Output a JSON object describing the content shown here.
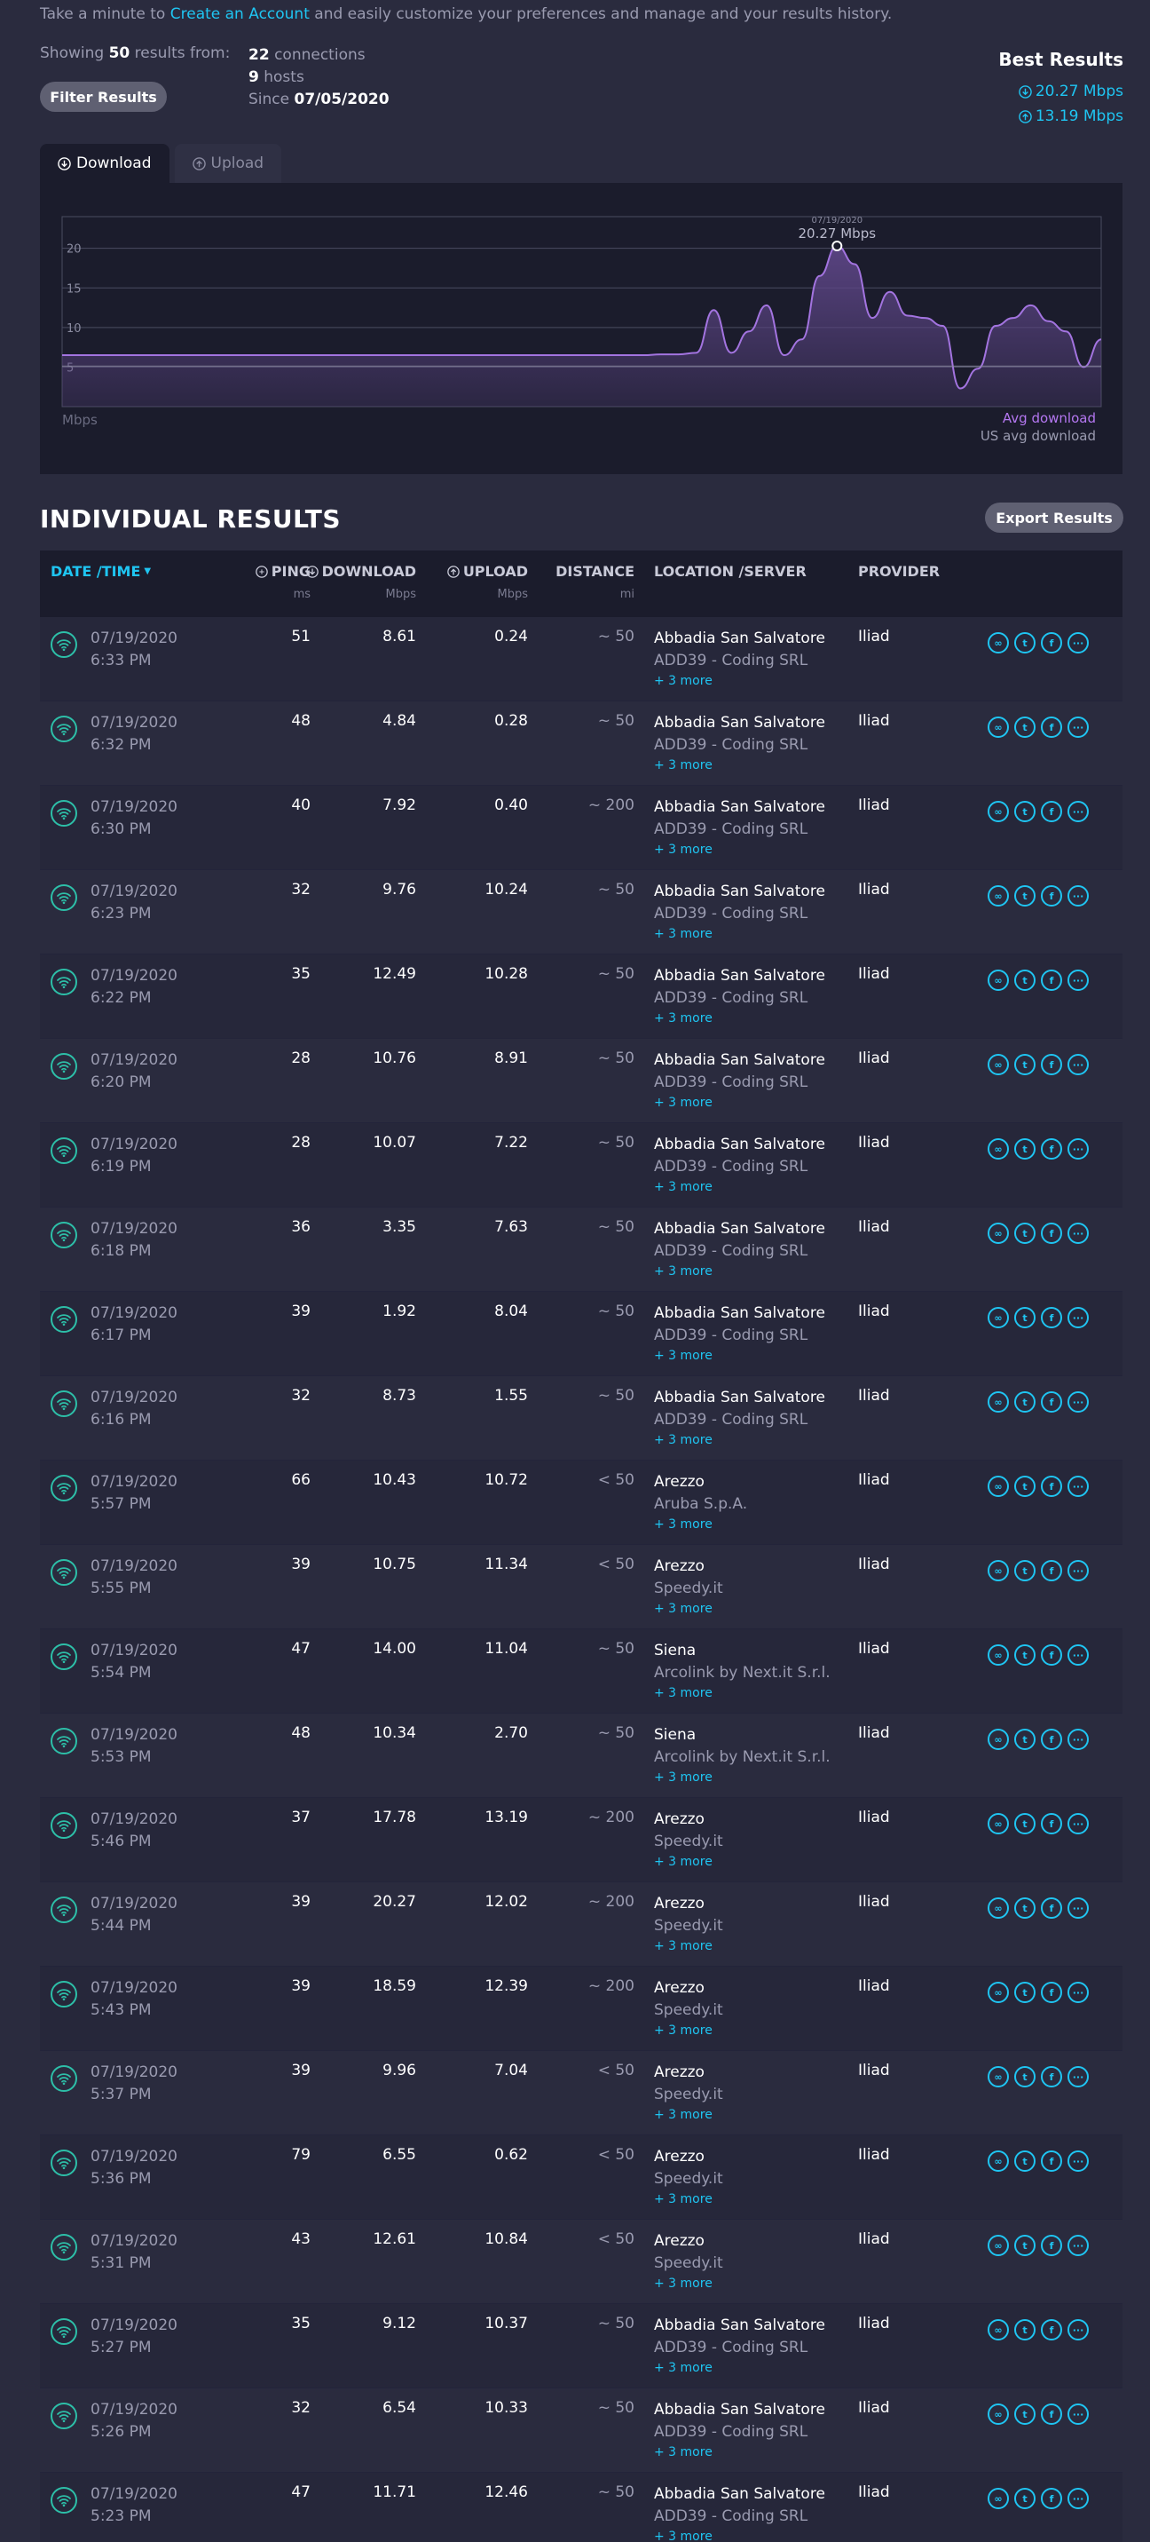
{
  "intro": {
    "before": "Take a minute to",
    "link": "Create an Account",
    "after": "and easily customize your preferences and manage and your results history."
  },
  "summary": {
    "showing_label": "Showing",
    "count": "50",
    "from_label": "results from:",
    "connections_count": "22",
    "connections_label": "connections",
    "hosts_count": "9",
    "hosts_label": "hosts",
    "since_label": "Since",
    "since_date": "07/05/2020"
  },
  "filter_button": "Filter Results",
  "best": {
    "title": "Best Results",
    "download": "20.27 Mbps",
    "upload": "13.19 Mbps"
  },
  "tabs": [
    {
      "label": "Download"
    },
    {
      "label": "Upload"
    }
  ],
  "chart": {
    "tooltip_date": "07/19/2020",
    "tooltip_value": "20.27 Mbps",
    "unit": "Mbps",
    "legend_avg": "Avg download",
    "legend_us": "US avg download",
    "colors": {
      "line": "#a374e0",
      "fill": "#5c4585",
      "us_line": "#8a8aa0"
    }
  },
  "chart_data": {
    "type": "area",
    "ylabel": "Mbps",
    "yticks": [
      "5",
      "10",
      "15",
      "20"
    ],
    "ylim": [
      0,
      24
    ],
    "series": [
      {
        "name": "Avg download",
        "values": [
          6.5,
          6.5,
          6.5,
          6.5,
          6.5,
          6.5,
          6.5,
          6.5,
          6.5,
          6.5,
          6.5,
          6.5,
          6.5,
          6.5,
          6.5,
          6.5,
          6.5,
          6.5,
          6.5,
          6.5,
          6.5,
          6.5,
          6.5,
          6.5,
          6.5,
          6.5,
          6.5,
          6.5,
          6.5,
          6.5,
          6.5,
          6.5,
          6.5,
          6.5,
          6.6,
          6.6,
          6.8,
          12.2,
          6.8,
          9.5,
          12.8,
          6.5,
          8.5,
          16.5,
          20.3,
          18.0,
          11.2,
          14.5,
          11.5,
          11.2,
          10.2,
          2.3,
          4.8,
          10.2,
          11.2,
          12.8,
          10.8,
          9.5,
          5.0,
          8.5
        ]
      },
      {
        "name": "US avg download",
        "values": [
          5.1,
          5.1,
          5.1,
          5.1,
          5.1,
          5.1,
          5.1,
          5.1,
          5.1,
          5.1,
          5.1,
          5.1,
          5.1,
          5.1,
          5.1,
          5.1,
          5.1,
          5.1,
          5.1,
          5.1,
          5.1,
          5.1,
          5.1,
          5.1,
          5.1,
          5.1,
          5.1,
          5.1,
          5.1,
          5.1,
          5.1,
          5.1,
          5.1,
          5.1,
          5.1,
          5.1,
          5.1,
          5.1,
          5.1,
          5.1,
          5.1,
          5.1,
          5.1,
          5.1,
          5.1,
          5.1,
          5.1,
          5.1,
          5.1,
          5.1,
          5.1,
          5.1,
          5.1,
          5.1,
          5.1,
          5.1,
          5.1,
          5.1,
          5.1,
          5.1
        ]
      }
    ]
  },
  "section_title": "INDIVIDUAL RESULTS",
  "export_button": "Export Results",
  "table": {
    "headers": {
      "date": "DATE /TIME",
      "ping": "PING",
      "ping_unit": "ms",
      "download": "DOWNLOAD",
      "download_unit": "Mbps",
      "upload": "UPLOAD",
      "upload_unit": "Mbps",
      "distance": "DISTANCE",
      "distance_unit": "mi",
      "location": "LOCATION /SERVER",
      "provider": "PROVIDER"
    },
    "rows": [
      {
        "date": "07/19/2020",
        "time": "6:33 PM",
        "ping": "51",
        "download": "8.61",
        "upload": "0.24",
        "distance": "~ 50",
        "city": "Abbadia San Salvatore",
        "server": "ADD39 - Coding SRL",
        "more": "+ 3 more",
        "provider": "Iliad"
      },
      {
        "date": "07/19/2020",
        "time": "6:32 PM",
        "ping": "48",
        "download": "4.84",
        "upload": "0.28",
        "distance": "~ 50",
        "city": "Abbadia San Salvatore",
        "server": "ADD39 - Coding SRL",
        "more": "+ 3 more",
        "provider": "Iliad"
      },
      {
        "date": "07/19/2020",
        "time": "6:30 PM",
        "ping": "40",
        "download": "7.92",
        "upload": "0.40",
        "distance": "~ 200",
        "city": "Abbadia San Salvatore",
        "server": "ADD39 - Coding SRL",
        "more": "+ 3 more",
        "provider": "Iliad"
      },
      {
        "date": "07/19/2020",
        "time": "6:23 PM",
        "ping": "32",
        "download": "9.76",
        "upload": "10.24",
        "distance": "~ 50",
        "city": "Abbadia San Salvatore",
        "server": "ADD39 - Coding SRL",
        "more": "+ 3 more",
        "provider": "Iliad"
      },
      {
        "date": "07/19/2020",
        "time": "6:22 PM",
        "ping": "35",
        "download": "12.49",
        "upload": "10.28",
        "distance": "~ 50",
        "city": "Abbadia San Salvatore",
        "server": "ADD39 - Coding SRL",
        "more": "+ 3 more",
        "provider": "Iliad"
      },
      {
        "date": "07/19/2020",
        "time": "6:20 PM",
        "ping": "28",
        "download": "10.76",
        "upload": "8.91",
        "distance": "~ 50",
        "city": "Abbadia San Salvatore",
        "server": "ADD39 - Coding SRL",
        "more": "+ 3 more",
        "provider": "Iliad"
      },
      {
        "date": "07/19/2020",
        "time": "6:19 PM",
        "ping": "28",
        "download": "10.07",
        "upload": "7.22",
        "distance": "~ 50",
        "city": "Abbadia San Salvatore",
        "server": "ADD39 - Coding SRL",
        "more": "+ 3 more",
        "provider": "Iliad"
      },
      {
        "date": "07/19/2020",
        "time": "6:18 PM",
        "ping": "36",
        "download": "3.35",
        "upload": "7.63",
        "distance": "~ 50",
        "city": "Abbadia San Salvatore",
        "server": "ADD39 - Coding SRL",
        "more": "+ 3 more",
        "provider": "Iliad"
      },
      {
        "date": "07/19/2020",
        "time": "6:17 PM",
        "ping": "39",
        "download": "1.92",
        "upload": "8.04",
        "distance": "~ 50",
        "city": "Abbadia San Salvatore",
        "server": "ADD39 - Coding SRL",
        "more": "+ 3 more",
        "provider": "Iliad"
      },
      {
        "date": "07/19/2020",
        "time": "6:16 PM",
        "ping": "32",
        "download": "8.73",
        "upload": "1.55",
        "distance": "~ 50",
        "city": "Abbadia San Salvatore",
        "server": "ADD39 - Coding SRL",
        "more": "+ 3 more",
        "provider": "Iliad"
      },
      {
        "date": "07/19/2020",
        "time": "5:57 PM",
        "ping": "66",
        "download": "10.43",
        "upload": "10.72",
        "distance": "< 50",
        "city": "Arezzo",
        "server": "Aruba S.p.A.",
        "more": "+ 3 more",
        "provider": "Iliad"
      },
      {
        "date": "07/19/2020",
        "time": "5:55 PM",
        "ping": "39",
        "download": "10.75",
        "upload": "11.34",
        "distance": "< 50",
        "city": "Arezzo",
        "server": "Speedy.it",
        "more": "+ 3 more",
        "provider": "Iliad"
      },
      {
        "date": "07/19/2020",
        "time": "5:54 PM",
        "ping": "47",
        "download": "14.00",
        "upload": "11.04",
        "distance": "~ 50",
        "city": "Siena",
        "server": "Arcolink by Next.it S.r.l.",
        "more": "+ 3 more",
        "provider": "Iliad"
      },
      {
        "date": "07/19/2020",
        "time": "5:53 PM",
        "ping": "48",
        "download": "10.34",
        "upload": "2.70",
        "distance": "~ 50",
        "city": "Siena",
        "server": "Arcolink by Next.it S.r.l.",
        "more": "+ 3 more",
        "provider": "Iliad"
      },
      {
        "date": "07/19/2020",
        "time": "5:46 PM",
        "ping": "37",
        "download": "17.78",
        "upload": "13.19",
        "distance": "~ 200",
        "city": "Arezzo",
        "server": "Speedy.it",
        "more": "+ 3 more",
        "provider": "Iliad"
      },
      {
        "date": "07/19/2020",
        "time": "5:44 PM",
        "ping": "39",
        "download": "20.27",
        "upload": "12.02",
        "distance": "~ 200",
        "city": "Arezzo",
        "server": "Speedy.it",
        "more": "+ 3 more",
        "provider": "Iliad"
      },
      {
        "date": "07/19/2020",
        "time": "5:43 PM",
        "ping": "39",
        "download": "18.59",
        "upload": "12.39",
        "distance": "~ 200",
        "city": "Arezzo",
        "server": "Speedy.it",
        "more": "+ 3 more",
        "provider": "Iliad"
      },
      {
        "date": "07/19/2020",
        "time": "5:37 PM",
        "ping": "39",
        "download": "9.96",
        "upload": "7.04",
        "distance": "< 50",
        "city": "Arezzo",
        "server": "Speedy.it",
        "more": "+ 3 more",
        "provider": "Iliad"
      },
      {
        "date": "07/19/2020",
        "time": "5:36 PM",
        "ping": "79",
        "download": "6.55",
        "upload": "0.62",
        "distance": "< 50",
        "city": "Arezzo",
        "server": "Speedy.it",
        "more": "+ 3 more",
        "provider": "Iliad"
      },
      {
        "date": "07/19/2020",
        "time": "5:31 PM",
        "ping": "43",
        "download": "12.61",
        "upload": "10.84",
        "distance": "< 50",
        "city": "Arezzo",
        "server": "Speedy.it",
        "more": "+ 3 more",
        "provider": "Iliad"
      },
      {
        "date": "07/19/2020",
        "time": "5:27 PM",
        "ping": "35",
        "download": "9.12",
        "upload": "10.37",
        "distance": "~ 50",
        "city": "Abbadia San Salvatore",
        "server": "ADD39 - Coding SRL",
        "more": "+ 3 more",
        "provider": "Iliad"
      },
      {
        "date": "07/19/2020",
        "time": "5:26 PM",
        "ping": "32",
        "download": "6.54",
        "upload": "10.33",
        "distance": "~ 50",
        "city": "Abbadia San Salvatore",
        "server": "ADD39 - Coding SRL",
        "more": "+ 3 more",
        "provider": "Iliad"
      },
      {
        "date": "07/19/2020",
        "time": "5:23 PM",
        "ping": "47",
        "download": "11.71",
        "upload": "12.46",
        "distance": "~ 50",
        "city": "Abbadia San Salvatore",
        "server": "ADD39 - Coding SRL",
        "more": "+ 3 more",
        "provider": "Iliad"
      }
    ]
  }
}
